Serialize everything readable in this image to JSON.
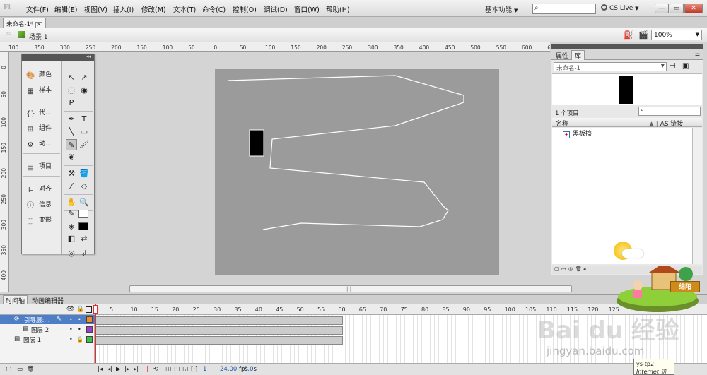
{
  "app": {
    "logo": "Fl",
    "menu": [
      "文件(F)",
      "编辑(E)",
      "视图(V)",
      "插入(I)",
      "修改(M)",
      "文本(T)",
      "命令(C)",
      "控制(O)",
      "调试(D)",
      "窗口(W)",
      "帮助(H)"
    ],
    "workspace_label": "基本功能",
    "search_placeholder": "",
    "cslive_label": "CS Live",
    "window_buttons": [
      "—",
      "▭",
      "✕"
    ]
  },
  "document": {
    "tab_title": "未命名-1*",
    "scene_label": "场景 1",
    "zoom": "100%"
  },
  "rulers": {
    "h_ticks": [
      "100",
      "350",
      "300",
      "250",
      "200",
      "150",
      "100",
      "50",
      "0",
      "50",
      "100",
      "150",
      "200",
      "250",
      "300",
      "350",
      "400",
      "450",
      "500",
      "550",
      "600",
      "650"
    ],
    "v_ticks": [
      "0",
      "50",
      "100",
      "150",
      "200",
      "250",
      "300",
      "350",
      "400"
    ]
  },
  "side_panel": {
    "items": [
      {
        "icon": "color-icon",
        "label": "颜色"
      },
      {
        "icon": "swatches-icon",
        "label": "样本"
      },
      {
        "icon": "code-icon",
        "label": "代..."
      },
      {
        "icon": "components-icon",
        "label": "组件"
      },
      {
        "icon": "motion-presets-icon",
        "label": "动..."
      },
      {
        "icon": "project-icon",
        "label": "项目"
      },
      {
        "icon": "align-icon",
        "label": "对齐"
      },
      {
        "icon": "info-icon",
        "label": "信息"
      },
      {
        "icon": "transform-icon",
        "label": "变形"
      }
    ]
  },
  "library": {
    "tabs": [
      "属性",
      "库"
    ],
    "active_tab": "库",
    "doc_select": "未命名-1",
    "items_count": "1 个项目",
    "col_name": "名称",
    "col_as": "AS 链接",
    "items": [
      {
        "name": "黑板擦"
      }
    ]
  },
  "timeline": {
    "tabs": [
      "时间轴",
      "动画编辑器"
    ],
    "frame_numbers": [
      "1",
      "5",
      "10",
      "15",
      "20",
      "25",
      "30",
      "35",
      "40",
      "45",
      "50",
      "55",
      "60",
      "65",
      "70",
      "75",
      "80",
      "85",
      "90",
      "95",
      "100",
      "105",
      "110",
      "115",
      "120",
      "125",
      "130",
      "135"
    ],
    "layers": [
      {
        "name": "引导层:...",
        "color": "#f08a24",
        "selected": true
      },
      {
        "name": "图层 2",
        "color": "#9b3ecb",
        "selected": false
      },
      {
        "name": "图层 1",
        "color": "#38c24a",
        "selected": false
      }
    ],
    "current_frame": "1",
    "fps": "24.00",
    "fps_unit": "fps",
    "time": "0.0",
    "time_unit": "s"
  },
  "watermark": {
    "sign": "绵阳",
    "brand": "Bai du 经验",
    "url": "jingyan.baidu.com"
  },
  "tooltip": {
    "line1": "ys-tp2",
    "line2": "Internet 访问"
  },
  "colors": {
    "stage": "#9b9b9b",
    "selection": "#4d7ec6",
    "playhead": "#e03030"
  }
}
